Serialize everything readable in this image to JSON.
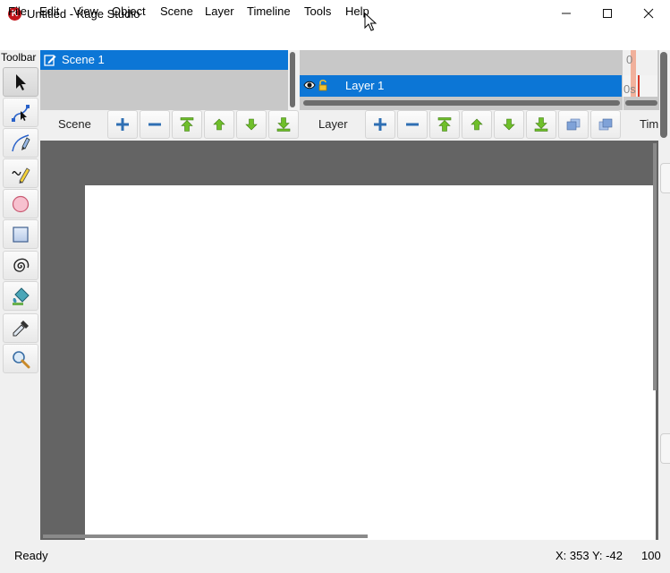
{
  "window": {
    "app_icon_letter": "K",
    "title": "Untitled - Kage Studio",
    "controls": {
      "minimize": "—",
      "maximize": "☐",
      "close": "✕"
    }
  },
  "menu": [
    "File",
    "Edit",
    "View",
    "Object",
    "Scene",
    "Layer",
    "Timeline",
    "Tools",
    "Help"
  ],
  "toolbar": {
    "label": "Toolbar",
    "tools": [
      {
        "icon": "select-arrow-icon",
        "active": true
      },
      {
        "icon": "node-edit-icon",
        "active": false
      },
      {
        "icon": "pen-curve-icon",
        "active": false
      },
      {
        "icon": "pencil-icon",
        "active": false
      },
      {
        "icon": "ellipse-icon",
        "active": false
      },
      {
        "icon": "rectangle-icon",
        "active": false
      },
      {
        "icon": "spiral-icon",
        "active": false
      },
      {
        "icon": "paint-bucket-icon",
        "active": false
      },
      {
        "icon": "eyedropper-icon",
        "active": false
      },
      {
        "icon": "zoom-icon",
        "active": false
      }
    ]
  },
  "scenes": {
    "items": [
      {
        "name": "Scene 1",
        "selected": true
      }
    ],
    "action_label": "Scene"
  },
  "layers": {
    "items": [
      {
        "name": "Layer 1",
        "visible": true,
        "locked": false,
        "selected": true
      }
    ],
    "action_label": "Layer"
  },
  "timeline": {
    "ruler_text": "0",
    "row_text": "0s",
    "action_label": "Tim"
  },
  "actions": {
    "add": "+",
    "remove": "−"
  },
  "status": {
    "text": "Ready",
    "coords": "X: 353 Y: -42",
    "zoom": "100"
  },
  "colors": {
    "selection": "#0c76d6",
    "canvas_bg": "#646464",
    "paper": "#ffffff",
    "arrow_green": "#6fbf2a",
    "plus_blue": "#2f6fb3",
    "app_icon": "#c3161c"
  }
}
